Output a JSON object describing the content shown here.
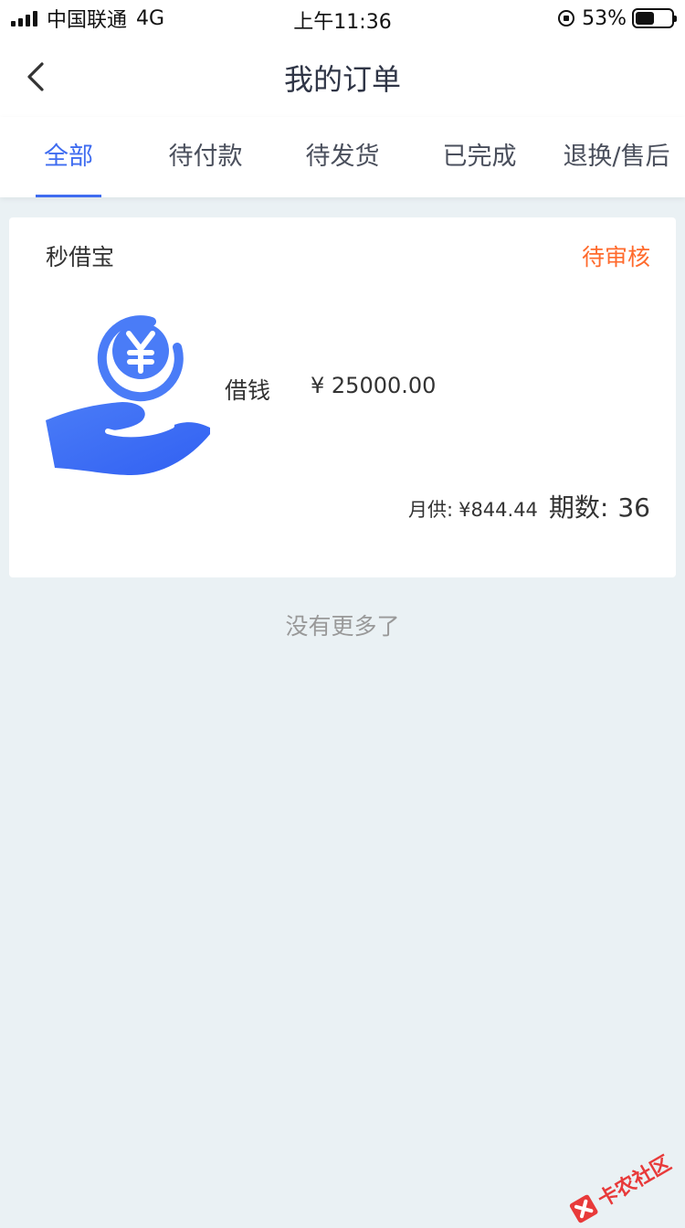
{
  "status_bar": {
    "carrier": "中国联通",
    "network": "4G",
    "time": "上午11:36",
    "battery_percent": "53%",
    "battery_level": 0.53
  },
  "nav": {
    "title": "我的订单"
  },
  "tabs": [
    {
      "label": "全部",
      "active": true
    },
    {
      "label": "待付款",
      "active": false
    },
    {
      "label": "待发货",
      "active": false
    },
    {
      "label": "已完成",
      "active": false
    },
    {
      "label": "退换/售后",
      "active": false
    }
  ],
  "order": {
    "merchant": "秒借宝",
    "status": "待审核",
    "product_name": "借钱",
    "amount": "¥ 25000.00",
    "monthly_label": "月供:",
    "monthly_value": "¥844.44",
    "periods_label": "期数:",
    "periods_value": "36",
    "icon": "hand-coin-yuan-icon"
  },
  "footer": {
    "no_more": "没有更多了"
  },
  "watermark": {
    "text": "卡农社区"
  },
  "colors": {
    "accent": "#3f6cf0",
    "status_orange": "#ff6a2c",
    "background": "#eaf1f4"
  }
}
